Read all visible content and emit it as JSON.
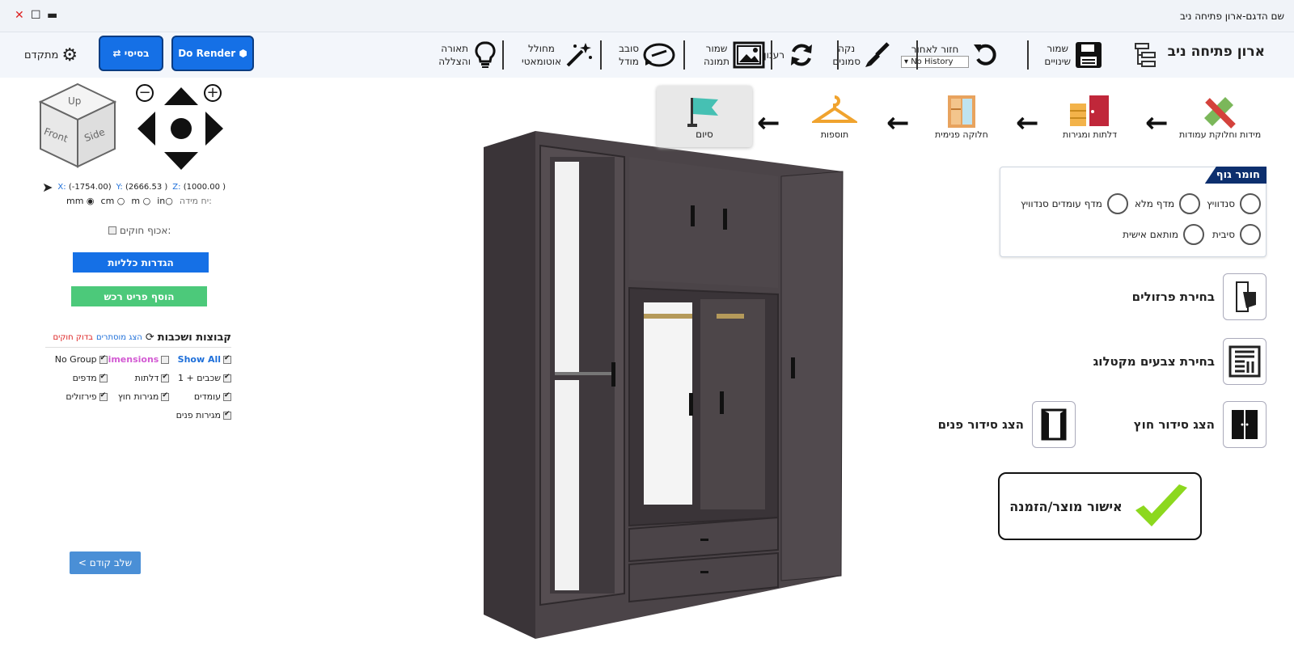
{
  "window": {
    "title": "שם הדגם-ארון פתיחה ניב"
  },
  "toolbar": {
    "app_title": "ארון פתיחה ניב",
    "save_label_1": "שמור",
    "save_label_2": "שינויים",
    "undo_label": "חזור לאחור",
    "history_value": "No History",
    "clean_label_1": "נקה",
    "clean_label_2": "סמונים",
    "refresh_label": "רענון",
    "save_image_1": "שמור",
    "save_image_2": "תמונה",
    "rotate_1": "סובב",
    "rotate_2": "מודל",
    "auto_1": "מחולל",
    "auto_2": "אוטומאטי",
    "light_1": "תאורה",
    "light_2": "והצללה",
    "do_render": "Do Render",
    "basic": "בסיסי",
    "advanced": "מתקדם"
  },
  "view": {
    "cube_up": "Up",
    "cube_front": "Front",
    "cube_side": "Side",
    "coord_x_label": "X:",
    "coord_x": "(-1754.00)",
    "coord_y_label": "Y:",
    "coord_y": "(2666.53 )",
    "coord_z_label": "Z:",
    "coord_z": "(1000.00 )",
    "units_label": "יח מידה:",
    "units": [
      "mm",
      "cm",
      "m",
      "in"
    ],
    "flip_handles": "אכוף חוקים:",
    "general_settings": "הגדרות כלליות",
    "add_furniture": "הוסף פריט רכש",
    "prev_step": "< שלב קודם"
  },
  "layers": {
    "title": "קבוצות ושכבות",
    "show_hidden": "הצג מוסתרים",
    "check_rules": "בדוק חוקים",
    "items": [
      {
        "label": "Show All",
        "checked": true,
        "color": "#1e6fd9"
      },
      {
        "label": "imensions",
        "checked": false,
        "color": "#d35ad3"
      },
      {
        "label": "No Group",
        "checked": true,
        "color": "#222"
      },
      {
        "label": "שכבים + 1",
        "checked": true,
        "color": "#222"
      },
      {
        "label": "דלתות",
        "checked": true,
        "color": "#222"
      },
      {
        "label": "מדפים",
        "checked": true,
        "color": "#222"
      },
      {
        "label": "עומדים",
        "checked": true,
        "color": "#222"
      },
      {
        "label": "מגירות חוץ",
        "checked": true,
        "color": "#222"
      },
      {
        "label": "פירזולים",
        "checked": true,
        "color": "#222"
      },
      {
        "label": "מגירות פנים",
        "checked": true,
        "color": "#222"
      }
    ]
  },
  "steps": [
    {
      "label": "מידות וחלוקת עמודות"
    },
    {
      "label": "דלתות ומגירות"
    },
    {
      "label": "חלוקה פנימית"
    },
    {
      "label": "תוספות"
    },
    {
      "label": "סיום"
    }
  ],
  "material": {
    "title": "חומר גוף",
    "options": [
      "סנדוויץ",
      "מדף מלא",
      "מדף עומדים סנדוויץ",
      "סיבית",
      "מותאם אישית"
    ]
  },
  "side_panel": {
    "hardware": "בחירת פרזולים",
    "catalog": "בחירת צבעים מקטלוג",
    "outer_layout": "הצג סידור חוץ",
    "inner_layout": "הצג סידור פנים",
    "confirm": "אישור מוצר/הזמנה"
  },
  "colors": {
    "accent": "#1570e6",
    "green": "#4cc97a",
    "navy": "#0d2f6e",
    "wood": "#514a4e"
  }
}
